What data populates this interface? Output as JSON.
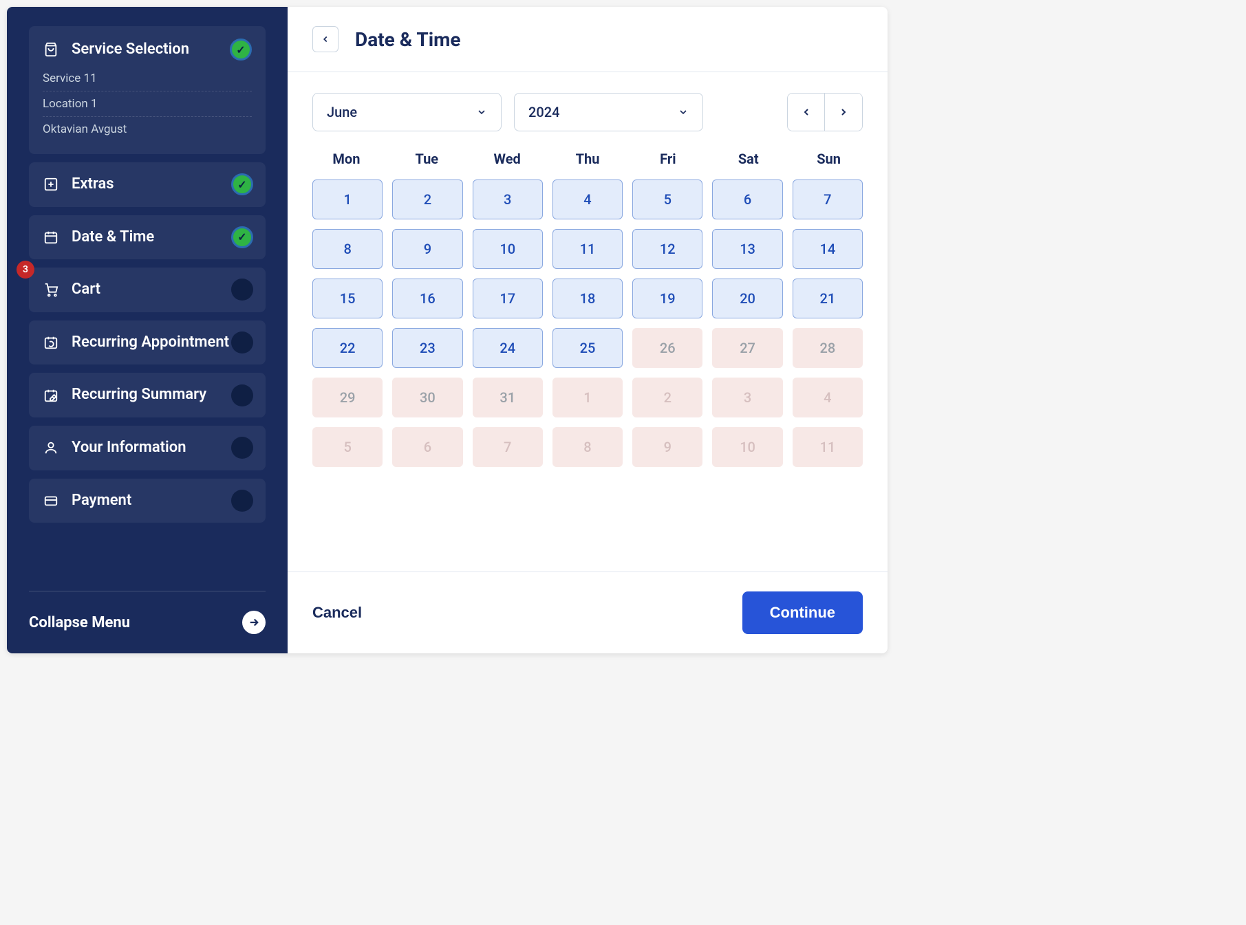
{
  "sidebar": {
    "steps": {
      "service": {
        "label": "Service Selection",
        "details": [
          "Service 11",
          "Location 1",
          "Oktavian Avgust"
        ]
      },
      "extras": {
        "label": "Extras"
      },
      "datetime": {
        "label": "Date & Time"
      },
      "cart": {
        "label": "Cart",
        "badge": "3"
      },
      "recurring": {
        "label": "Recurring Appointment"
      },
      "summary": {
        "label": "Recurring Summary"
      },
      "info": {
        "label": "Your Information"
      },
      "payment": {
        "label": "Payment"
      }
    },
    "collapse": "Collapse Menu"
  },
  "header": {
    "title": "Date & Time"
  },
  "picker": {
    "month": "June",
    "year": "2024"
  },
  "calendar": {
    "weekdays": [
      "Mon",
      "Tue",
      "Wed",
      "Thu",
      "Fri",
      "Sat",
      "Sun"
    ],
    "cells": [
      {
        "n": "1",
        "state": "avail"
      },
      {
        "n": "2",
        "state": "avail"
      },
      {
        "n": "3",
        "state": "avail"
      },
      {
        "n": "4",
        "state": "avail"
      },
      {
        "n": "5",
        "state": "avail"
      },
      {
        "n": "6",
        "state": "avail"
      },
      {
        "n": "7",
        "state": "avail"
      },
      {
        "n": "8",
        "state": "avail"
      },
      {
        "n": "9",
        "state": "avail"
      },
      {
        "n": "10",
        "state": "avail"
      },
      {
        "n": "11",
        "state": "avail"
      },
      {
        "n": "12",
        "state": "avail"
      },
      {
        "n": "13",
        "state": "avail"
      },
      {
        "n": "14",
        "state": "avail"
      },
      {
        "n": "15",
        "state": "avail"
      },
      {
        "n": "16",
        "state": "avail"
      },
      {
        "n": "17",
        "state": "avail"
      },
      {
        "n": "18",
        "state": "avail"
      },
      {
        "n": "19",
        "state": "avail"
      },
      {
        "n": "20",
        "state": "avail"
      },
      {
        "n": "21",
        "state": "avail"
      },
      {
        "n": "22",
        "state": "avail"
      },
      {
        "n": "23",
        "state": "avail"
      },
      {
        "n": "24",
        "state": "avail"
      },
      {
        "n": "25",
        "state": "avail"
      },
      {
        "n": "26",
        "state": "unavail"
      },
      {
        "n": "27",
        "state": "unavail"
      },
      {
        "n": "28",
        "state": "unavail"
      },
      {
        "n": "29",
        "state": "unavail"
      },
      {
        "n": "30",
        "state": "unavail"
      },
      {
        "n": "31",
        "state": "unavail"
      },
      {
        "n": "1",
        "state": "faded"
      },
      {
        "n": "2",
        "state": "faded"
      },
      {
        "n": "3",
        "state": "faded"
      },
      {
        "n": "4",
        "state": "faded"
      },
      {
        "n": "5",
        "state": "faded"
      },
      {
        "n": "6",
        "state": "faded"
      },
      {
        "n": "7",
        "state": "faded"
      },
      {
        "n": "8",
        "state": "faded"
      },
      {
        "n": "9",
        "state": "faded"
      },
      {
        "n": "10",
        "state": "faded"
      },
      {
        "n": "11",
        "state": "faded"
      }
    ]
  },
  "footer": {
    "cancel": "Cancel",
    "continue": "Continue"
  },
  "colors": {
    "sidebar": "#1a2b5c",
    "accent": "#2754d8",
    "success": "#2fb344"
  }
}
